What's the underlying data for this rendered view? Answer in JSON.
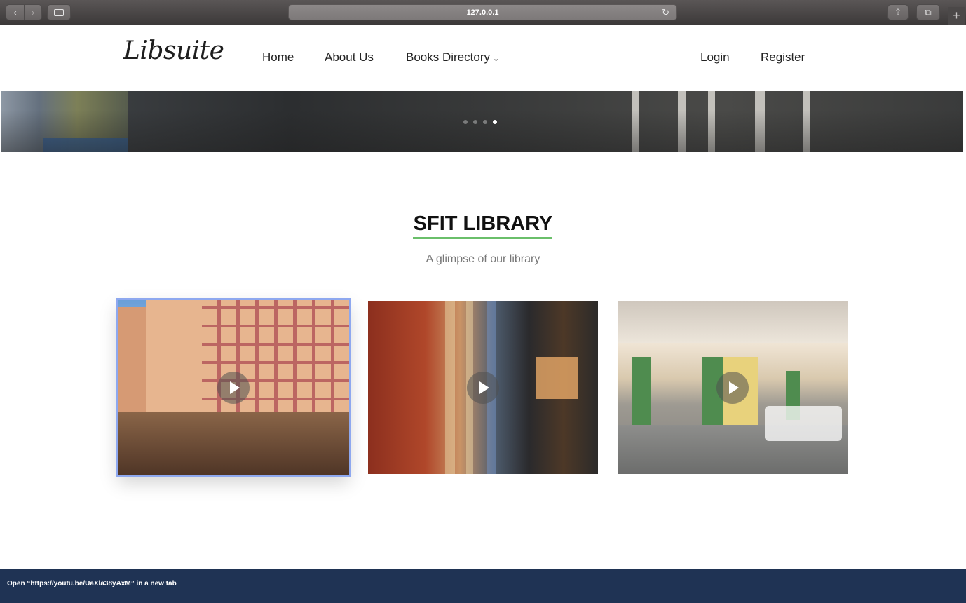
{
  "browser": {
    "url": "127.0.0.1",
    "back_glyph": "‹",
    "forward_glyph": "›",
    "reload_glyph": "↻",
    "share_glyph": "⇪",
    "tabs_glyph": "⧉",
    "newtab_glyph": "+"
  },
  "header": {
    "logo": "Libsuite",
    "nav": {
      "home": "Home",
      "about": "About Us",
      "books": "Books Directory",
      "books_chevron": "⌄",
      "login": "Login",
      "register": "Register"
    }
  },
  "hero": {
    "slide_count": 4,
    "active_slide": 4
  },
  "main": {
    "title": "SFIT LIBRARY",
    "subtitle": "A glimpse of our library",
    "accent_color": "#6abf6a",
    "videos": [
      {
        "name": "building"
      },
      {
        "name": "books"
      },
      {
        "name": "reading-room"
      }
    ]
  },
  "status_bar": {
    "text": "Open “https://youtu.be/UaXla38yAxM” in a new tab"
  },
  "colors": {
    "footer": "#1f3354",
    "focus_outline": "#8ea8ef"
  }
}
